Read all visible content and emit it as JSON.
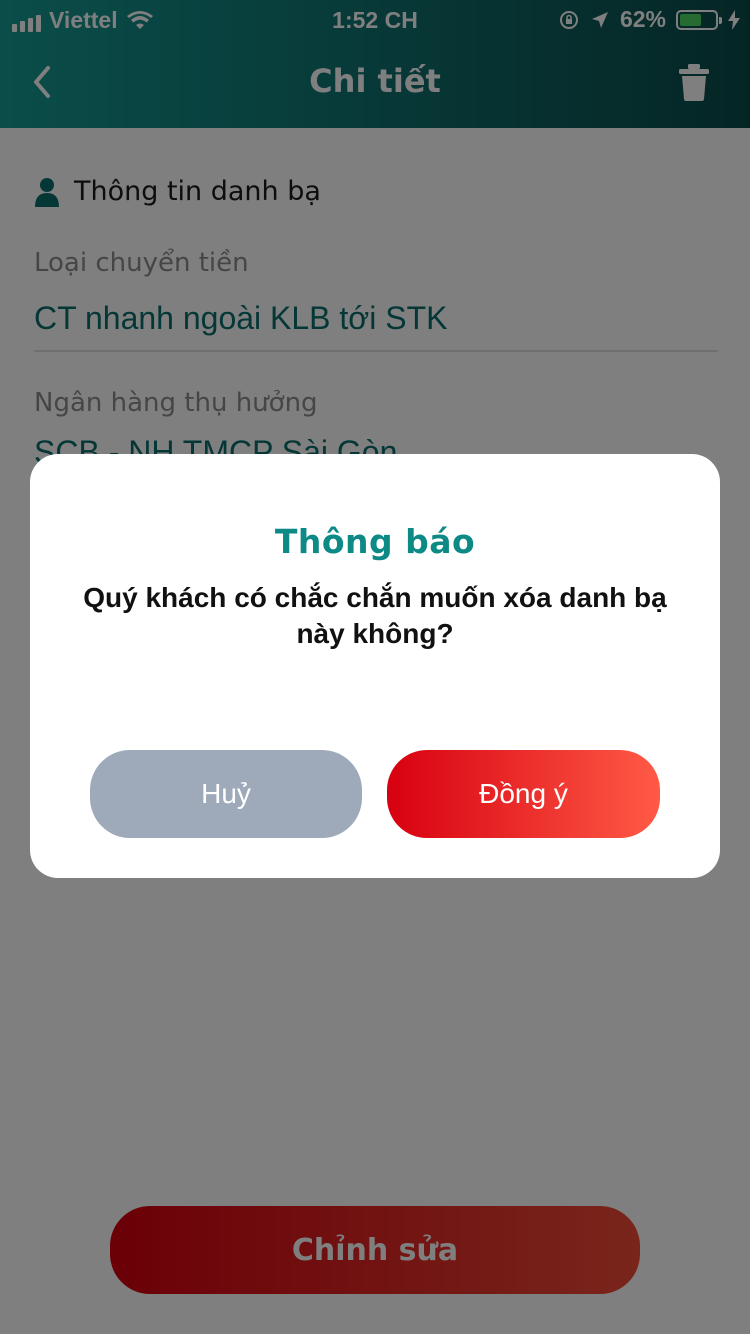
{
  "status_bar": {
    "carrier": "Viettel",
    "time": "1:52 CH",
    "battery_percent": "62%",
    "battery_level": 0.62,
    "battery_color": "#4cd964"
  },
  "header": {
    "title": "Chi tiết",
    "back_icon": "chevron-left-icon",
    "delete_icon": "trash-icon",
    "gradient": [
      "#159b93",
      "#0a4b4a"
    ]
  },
  "contact_info": {
    "section_title": "Thông tin danh bạ",
    "section_icon": "person-icon",
    "transfer_type_label": "Loại chuyển tiền",
    "transfer_type_value": "CT nhanh ngoài KLB tới STK",
    "bank_label": "Ngân hàng thụ hưởng",
    "bank_value": "SCB - NH TMCP Sài Gòn"
  },
  "footer": {
    "edit_label": "Chỉnh sửa"
  },
  "dialog": {
    "title": "Thông báo",
    "message": "Quý khách có chắc chắn muốn xóa danh bạ này không?",
    "cancel_label": "Huỷ",
    "confirm_label": "Đồng ý",
    "title_color": "#0e8a86",
    "cancel_color": "#9ea9ba",
    "confirm_color": "#d70010"
  }
}
